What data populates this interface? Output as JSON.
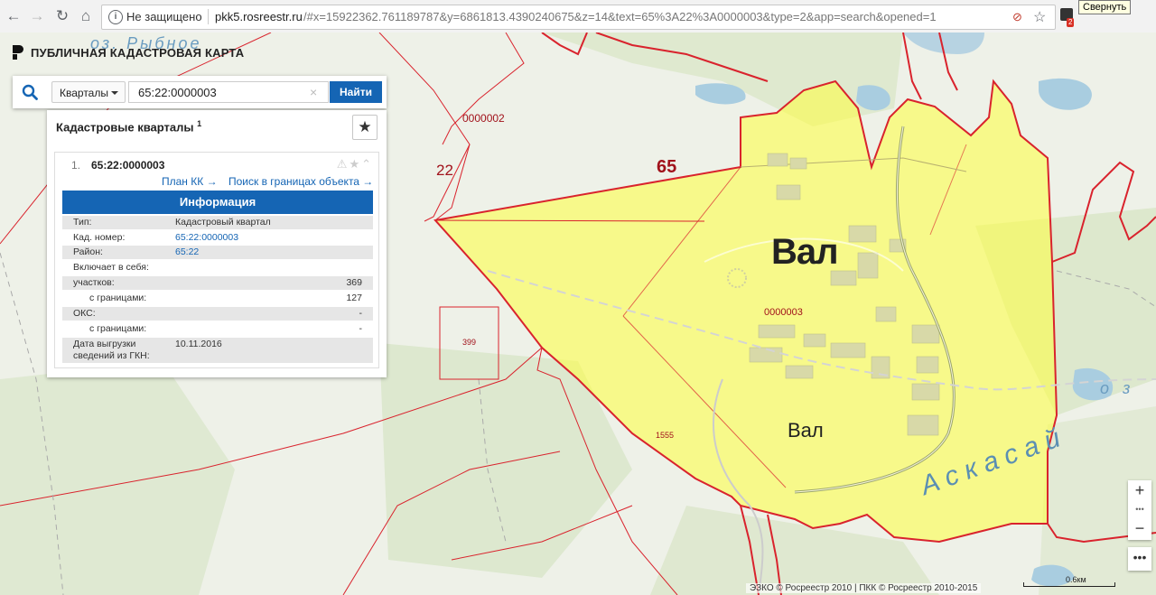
{
  "browser": {
    "security_text": "Не защищено",
    "url_host": "pkk5.rosreestr.ru",
    "url_rest": "/#x=15922362.761189787&y=6861813.4390240675&z=14&text=65%3A22%3A0000003&type=2&app=search&opened=1",
    "extension_badge": "2",
    "tooltip": "Свернуть"
  },
  "app": {
    "title": "ПУБЛИЧНАЯ КАДАСТРОВАЯ КАРТА"
  },
  "search": {
    "type_selected": "Кварталы",
    "query": "65:22:0000003",
    "button": "Найти"
  },
  "results": {
    "title": "Кадастровые кварталы",
    "count": "1",
    "item": {
      "index": "1.",
      "number": "65:22:0000003",
      "link_plan": "План КК →",
      "link_search": "Поиск в границах объекта →",
      "info_header": "Информация",
      "rows": [
        {
          "key": "Тип:",
          "value": "Кадастровый квартал"
        },
        {
          "key": "Кад. номер:",
          "value": "65:22:0000003"
        },
        {
          "key": "Район:",
          "value": "65:22"
        },
        {
          "key": "Включает в себя:",
          "value": ""
        },
        {
          "key": "участков:",
          "value": "369"
        },
        {
          "key": "с границами:",
          "value": "127"
        },
        {
          "key": "ОКС:",
          "value": "-"
        },
        {
          "key": "с границами:",
          "value": "-"
        },
        {
          "key": "Дата выгрузки сведений из ГКН:",
          "value": "10.11.2016"
        }
      ]
    }
  },
  "map": {
    "labels": {
      "val_big": "Вал",
      "val_small": "Вал",
      "region": "65",
      "district": "22",
      "quarter_main": "0000003",
      "quarter_top": "0000002",
      "parcel_399": "399",
      "parcel_1555": "1555",
      "river": "Аскасай",
      "lake_right": "о з",
      "lake_left": "оз. Рыбное"
    },
    "colors": {
      "selection_fill": "#ffff3c",
      "boundary": "#d9232d",
      "water": "#a9cde0"
    }
  },
  "controls": {
    "zoom_in": "+",
    "zoom_out": "−",
    "more": "•••",
    "scale_label": "0.6км",
    "copyright": "ЭЗКО © Росреестр 2010 | ПКК © Росреестр 2010-2015"
  }
}
